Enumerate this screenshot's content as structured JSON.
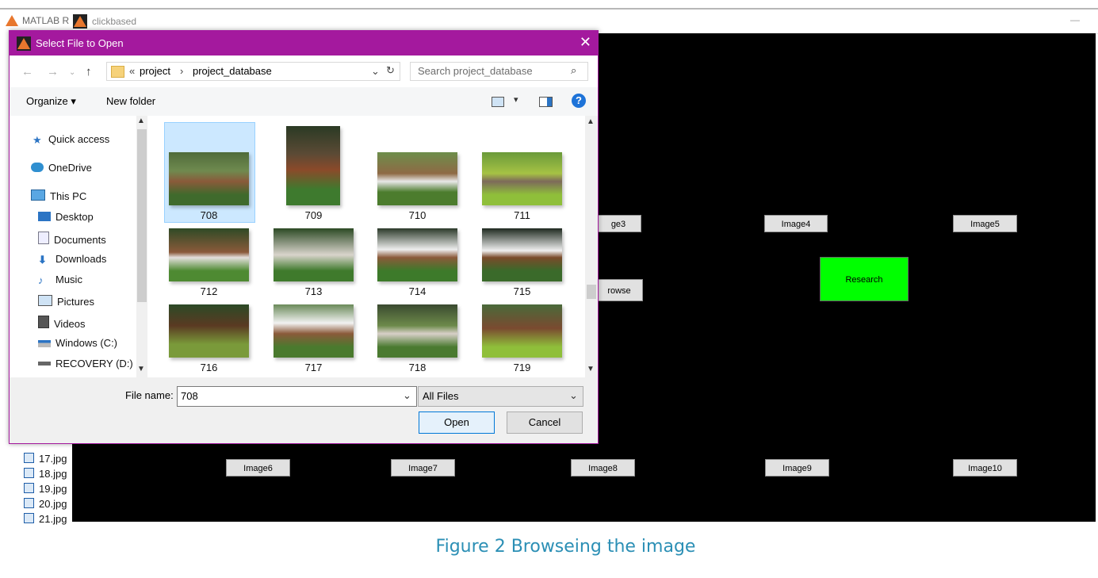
{
  "app": {
    "matlab_label": "MATLAB R",
    "figure_title": "clickbased",
    "minimize_symbol": "—"
  },
  "file_list": [
    "17.jpg",
    "18.jpg",
    "19.jpg",
    "20.jpg",
    "21.jpg"
  ],
  "figure_buttons": {
    "image3": "ge3",
    "image4": "Image4",
    "image5": "Image5",
    "browse": "rowse",
    "research": "Research",
    "image6": "Image6",
    "image7": "Image7",
    "image8": "Image8",
    "image9": "Image9",
    "image10": "Image10"
  },
  "dialog": {
    "title": "Select File to Open",
    "close_symbol": "✕",
    "breadcrumb_prefix": "«",
    "breadcrumb": [
      "project",
      "project_database"
    ],
    "search_placeholder": "Search project_database",
    "organize_label": "Organize ▾",
    "new_folder_label": "New folder",
    "nav_items": [
      {
        "label": "Quick access"
      },
      {
        "label": "OneDrive"
      },
      {
        "label": "This PC"
      },
      {
        "label": "Desktop"
      },
      {
        "label": "Documents"
      },
      {
        "label": "Downloads"
      },
      {
        "label": "Music"
      },
      {
        "label": "Pictures"
      },
      {
        "label": "Videos"
      },
      {
        "label": "Windows (C:)"
      },
      {
        "label": "RECOVERY (D:)"
      }
    ],
    "files": [
      "708",
      "709",
      "710",
      "711",
      "712",
      "713",
      "714",
      "715",
      "716",
      "717",
      "718",
      "719"
    ],
    "selected_file": "708",
    "file_name_label": "File name:",
    "file_name_value": "708",
    "filter_value": "All Files",
    "open_label": "Open",
    "cancel_label": "Cancel"
  },
  "caption": "Figure 2 Browseing the image",
  "colors": {
    "dialog_border": "#a4199e",
    "research_button": "#00ff00",
    "caption": "#2b8fb5",
    "figure_bg": "#000000"
  }
}
